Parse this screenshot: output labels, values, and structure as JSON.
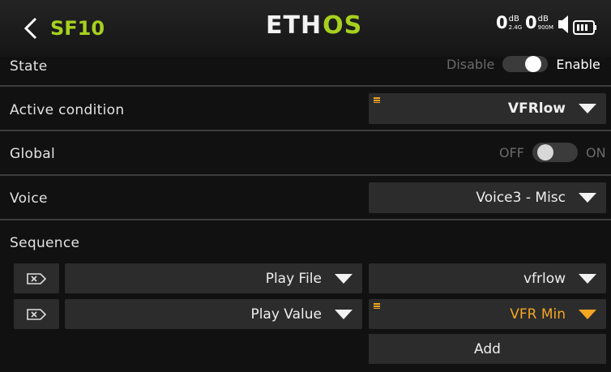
{
  "header": {
    "title": "SF10",
    "logo_main": "ETH",
    "logo_accent": "OS",
    "rssi_2g4": {
      "value": "0",
      "unit": "dB",
      "sub": "2.4G"
    },
    "rssi_900": {
      "value": "0",
      "unit": "dB",
      "sub": "900M"
    },
    "icons": [
      "back-arrow-icon",
      "speaker-icon",
      "battery-icon"
    ]
  },
  "rows": {
    "state": {
      "label": "State",
      "off_label": "Disable",
      "on_label": "Enable",
      "value": "Enable"
    },
    "active_condition": {
      "label": "Active condition",
      "value": "VFRlow"
    },
    "global": {
      "label": "Global",
      "off_label": "OFF",
      "on_label": "ON",
      "value": "OFF"
    },
    "voice": {
      "label": "Voice",
      "value": "Voice3 - Misc"
    },
    "sequence": {
      "label": "Sequence"
    }
  },
  "sequence_items": [
    {
      "action": "Play File",
      "value": "vfrlow"
    },
    {
      "action": "Play Value",
      "value": "VFR Min"
    }
  ],
  "add_label": "Add",
  "colors": {
    "accent_green": "#a6d11f",
    "accent_orange": "#f5a623",
    "field_bg": "#2c2c2c"
  }
}
